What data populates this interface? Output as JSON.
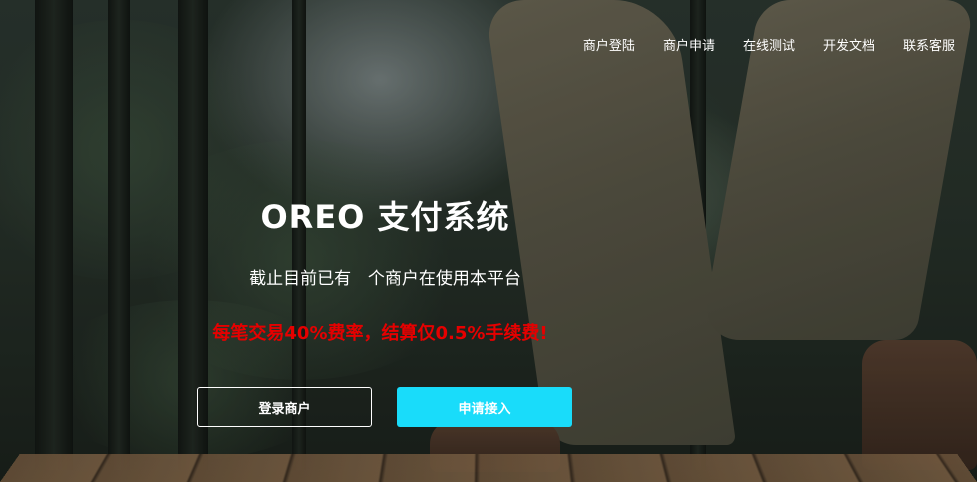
{
  "nav": {
    "items": [
      {
        "label": "商户登陆"
      },
      {
        "label": "商户申请"
      },
      {
        "label": "在线测试"
      },
      {
        "label": "开发文档"
      },
      {
        "label": "联系客服"
      }
    ]
  },
  "hero": {
    "title": "OREO 支付系统",
    "subtitle_prefix": "截止目前已有",
    "merchant_count": "",
    "subtitle_suffix": "个商户在使用本平台",
    "promo": "每笔交易40%费率，结算仅0.5%手续费!",
    "login_button": "登录商户",
    "apply_button": "申请接入"
  },
  "colors": {
    "accent": "#19dcfa",
    "promo": "#e60000",
    "text": "#ffffff"
  }
}
